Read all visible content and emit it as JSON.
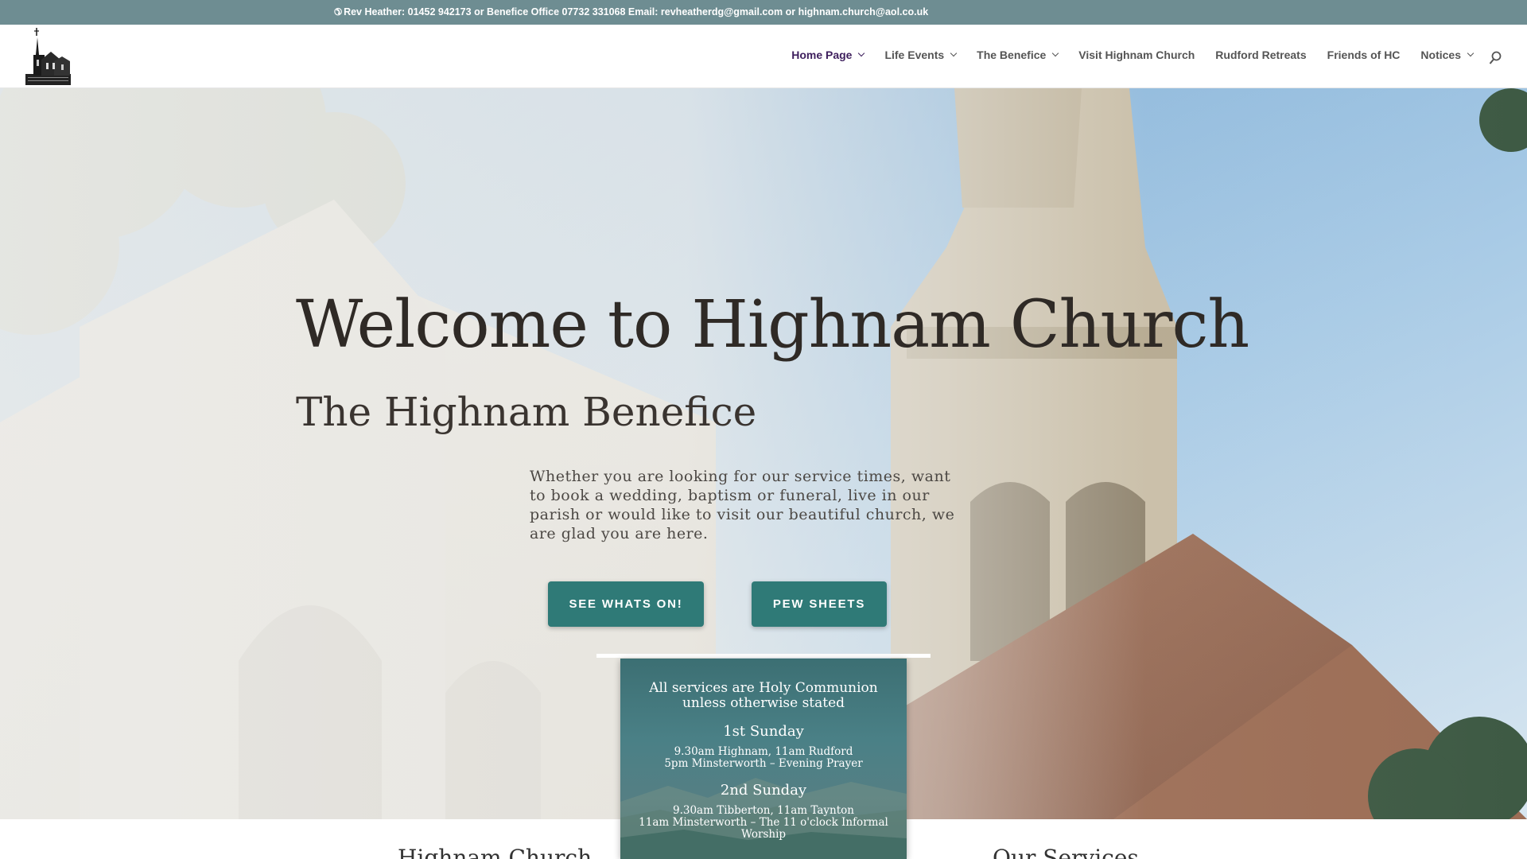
{
  "topbar": {
    "icon": "phone-icon",
    "contact": "Rev Heather: 01452 942173 or Benefice Office 07732 331068 Email: revheatherdg@gmail.com or highnam.church@aol.co.uk"
  },
  "header": {
    "logo_icon": "church-logo-icon",
    "nav": [
      {
        "label": "Home Page",
        "dropdown": true,
        "active": true
      },
      {
        "label": "Life Events",
        "dropdown": true
      },
      {
        "label": "The Benefice",
        "dropdown": true
      },
      {
        "label": "Visit Highnam Church",
        "dropdown": false
      },
      {
        "label": "Rudford Retreats",
        "dropdown": false
      },
      {
        "label": "Friends of HC",
        "dropdown": false
      },
      {
        "label": "Notices",
        "dropdown": true
      }
    ],
    "search_icon": "search-icon",
    "active_color": "#3e1f5d"
  },
  "hero": {
    "title": "Welcome to Highnam Church",
    "subtitle": "The Highnam Benefice",
    "text": "Whether you are looking for our service times, want to book a wedding, baptism or funeral, live in our parish or would like to visit our beautiful church, we are glad you are here.",
    "buttons": {
      "whats_on": "SEE WHATS ON!",
      "pew_sheets": "PEW SHEETS"
    },
    "button_color": "#2f7a77"
  },
  "services_card": {
    "heading": "All services are Holy Communion unless otherwise stated",
    "sundays": [
      {
        "title": "1st Sunday",
        "lines": [
          "9.30am Highnam, 11am Rudford",
          "5pm Minsterworth – Evening Prayer"
        ]
      },
      {
        "title": "2nd Sunday",
        "lines": [
          "9.30am Tibberton, 11am Taynton",
          "11am Minsterworth – The 11 o'clock Informal Worship"
        ]
      }
    ]
  },
  "below": {
    "left_heading": "Highnam Church",
    "right_heading": "Our Services"
  }
}
